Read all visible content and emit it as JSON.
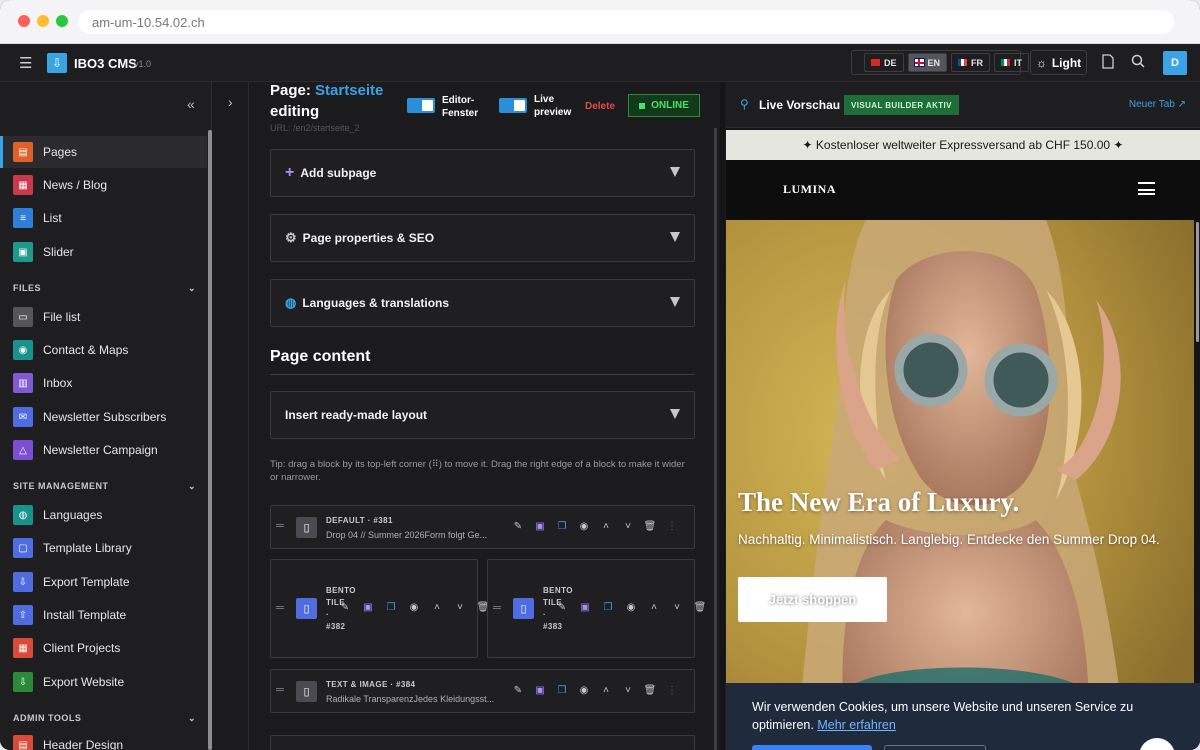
{
  "browser": {
    "url": "am-um-10.54.02.ch"
  },
  "topbar": {
    "app_name": "IBO3 CMS",
    "version": "v1.0",
    "languages": [
      {
        "code": "DE",
        "active": false
      },
      {
        "code": "EN",
        "active": true
      },
      {
        "code": "FR",
        "active": false
      },
      {
        "code": "IT",
        "active": false
      }
    ],
    "theme_label": "Light",
    "avatar_letter": "D"
  },
  "sidebar": {
    "items": [
      {
        "label": "Pages",
        "color": "#e0602a",
        "active": true
      },
      {
        "label": "News / Blog",
        "color": "#c83a4a"
      },
      {
        "label": "List",
        "color": "#2f7fd8"
      },
      {
        "label": "Slider",
        "color": "#1f9a8a"
      }
    ],
    "files_heading": "FILES",
    "files_items": [
      {
        "label": "File list",
        "color": "#55555a"
      },
      {
        "label": "Contact & Maps",
        "color": "#17928c"
      },
      {
        "label": "Inbox",
        "color": "#7e5bd0"
      },
      {
        "label": "Newsletter Subscribers",
        "color": "#4f6ce0"
      },
      {
        "label": "Newsletter Campaign",
        "color": "#7a4fd0"
      }
    ],
    "site_heading": "SITE MANAGEMENT",
    "site_items": [
      {
        "label": "Languages",
        "color": "#17928c"
      },
      {
        "label": "Template Library",
        "color": "#4f6ce0"
      },
      {
        "label": "Export Template",
        "color": "#4f6ce0"
      },
      {
        "label": "Install Template",
        "color": "#4f6ce0"
      },
      {
        "label": "Client Projects",
        "color": "#d84a3a"
      },
      {
        "label": "Export Website",
        "color": "#2a8a3a"
      }
    ],
    "admin_heading": "ADMIN TOOLS",
    "admin_items": [
      {
        "label": "Header Design",
        "color": "#d84a3a"
      }
    ]
  },
  "editor": {
    "page_prefix": "Page:",
    "page_name": "Startseite",
    "subtitle": "editing",
    "url_text": "URL: /en2/startseite_2",
    "toggle_editor": "Editor-\nFenster",
    "toggle_editor_1": "Editor-",
    "toggle_editor_2": "Fenster",
    "toggle_live_1": "Live",
    "toggle_live_2": "preview",
    "delete_label": "Delete",
    "status_label": "ONLINE",
    "accordions": [
      {
        "label": "Add subpage",
        "icon": "+"
      },
      {
        "label": "Page properties & SEO",
        "icon": "⚙"
      },
      {
        "label": "Languages & translations",
        "icon": "🌐"
      }
    ],
    "content_title": "Page content",
    "insert_layout": "Insert ready-made layout",
    "tip": "Tip: drag a block by its top-left corner (⠿) to move it. Drag the right edge of a block to make it wider or narrower.",
    "blocks": [
      {
        "title": "DEFAULT · #381",
        "desc": "Drop 04 // Summer 2026Form folgt Ge..."
      },
      {
        "title_1": "BENTO",
        "title_2": "TILE",
        "title_3": "·",
        "title_4": "#382"
      },
      {
        "title_1": "BENTO",
        "title_2": "TILE",
        "title_3": "·",
        "title_4": "#383"
      },
      {
        "title": "TEXT & IMAGE · #384",
        "desc": "Radikale TransparenzJedes Kleidungsst..."
      }
    ]
  },
  "preview": {
    "title": "Live Vorschau",
    "badge": "VISUAL BUILDER AKTIV",
    "new_tab": "Neuer Tab ↗",
    "promo": "✦ Kostenloser weltweiter Expressversand ab CHF 150.00 ✦",
    "logo": "LUMINA",
    "hero_title": "The New Era of Luxury.",
    "hero_text": "Nachhaltig. Minimalistisch. Langlebig. Entdecke den Summer Drop 04.",
    "hero_button": "Jetzt shoppen",
    "cookie_text": "Wir verwenden Cookies, um unsere Website und unseren Service zu optimieren.",
    "cookie_link": "Mehr erfahren"
  }
}
